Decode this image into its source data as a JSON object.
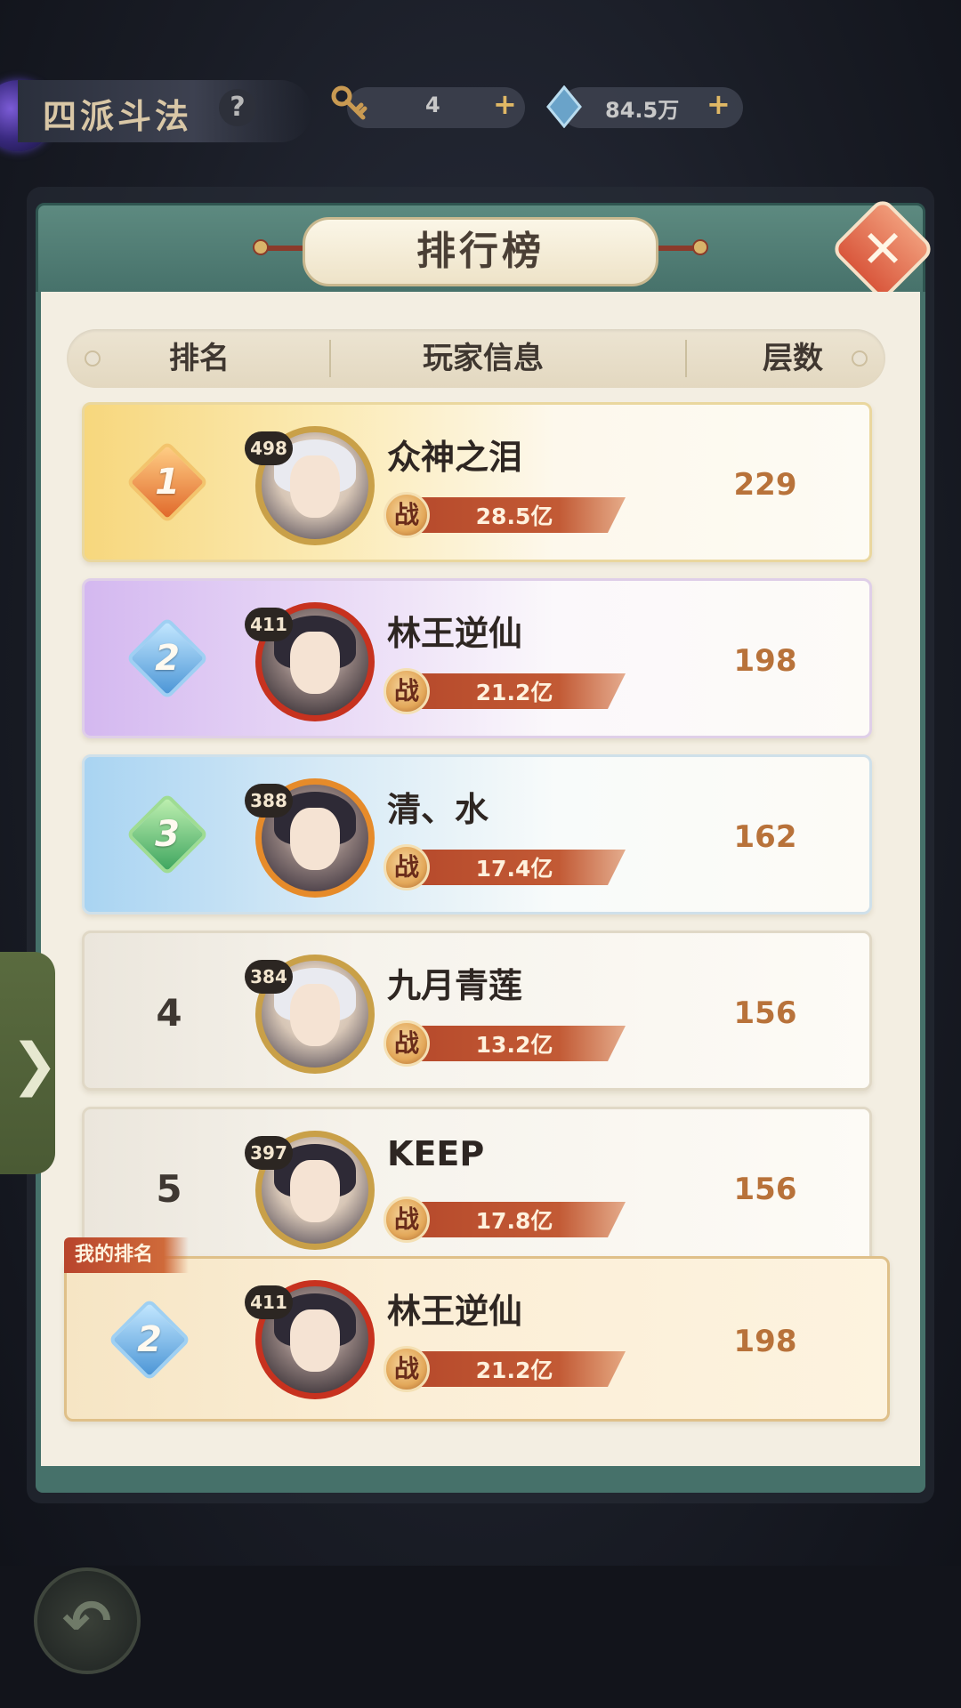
{
  "topbar": {
    "mode_title": "四派斗法",
    "help": "?",
    "resource1": {
      "icon": "key-icon",
      "value": "4",
      "plus": "+"
    },
    "resource2": {
      "icon": "gem-icon",
      "value": "84.5万",
      "plus": "+"
    }
  },
  "panel": {
    "title": "排行榜",
    "close": "✕"
  },
  "columns": {
    "rank": "排名",
    "player": "玩家信息",
    "floors": "层数"
  },
  "rows": [
    {
      "rank": "1",
      "level": "498",
      "name": "众神之泪",
      "power_prefix": "战",
      "power": "28.5亿",
      "floors": "229"
    },
    {
      "rank": "2",
      "level": "411",
      "name": "林王逆仙",
      "power_prefix": "战",
      "power": "21.2亿",
      "floors": "198"
    },
    {
      "rank": "3",
      "level": "388",
      "name": "清、水",
      "power_prefix": "战",
      "power": "17.4亿",
      "floors": "162"
    },
    {
      "rank": "4",
      "level": "384",
      "name": "九月青莲",
      "power_prefix": "战",
      "power": "13.2亿",
      "floors": "156"
    },
    {
      "rank": "5",
      "level": "397",
      "name": "KEEP",
      "power_prefix": "战",
      "power": "17.8亿",
      "floors": "156"
    }
  ],
  "my_rank": {
    "tag": "我的排名",
    "rank": "2",
    "level": "411",
    "name": "林王逆仙",
    "power_prefix": "战",
    "power": "21.2亿",
    "floors": "198"
  },
  "side_tab": {
    "arrow": "❯"
  },
  "back": {
    "icon": "back-arrow-icon",
    "glyph": "↶"
  },
  "colors": {
    "accent_teal": "#46716a",
    "close_red": "#d9573c",
    "floors_text": "#b8723a"
  }
}
